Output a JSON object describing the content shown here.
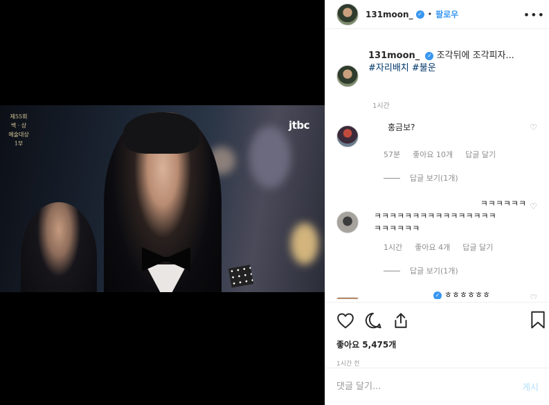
{
  "video": {
    "broadcaster_logo": "jtbc",
    "event_logo_lines": [
      "제55회",
      "백 · 상",
      "예술대상",
      "1부"
    ]
  },
  "header": {
    "username": "131moon_",
    "follow_label": "팔로우",
    "separator": "•",
    "more_icon": "more-icon"
  },
  "caption": {
    "username": "131moon_",
    "text": "조각뒤에 조각피자...",
    "hashtags": [
      "#자리배치",
      "#불운"
    ],
    "time": "1시간"
  },
  "comments": [
    {
      "text": "홍금보?",
      "time": "57분",
      "likes": "좋아요 10개",
      "reply_label": "답글 달기",
      "view_replies": "답글 보기(1개)"
    },
    {
      "text_lines": [
        "ㅋㅋㅋㅋㅋㅋ",
        "ㅋㅋㅋㅋㅋㅋㅋㅋㅋㅋㅋㅋㅋㅋㅋㅋ",
        "ㅋㅋㅋㅋㅋㅋ"
      ],
      "time": "1시간",
      "likes": "좋아요 4개",
      "reply_label": "답글 달기",
      "view_replies": "답글 보기(1개)"
    },
    {
      "text": "ㅎㅎㅎㅎㅎㅎ"
    }
  ],
  "actions": {
    "likes": "좋아요 5,475개",
    "time_ago": "1시간 전"
  },
  "comment_box": {
    "placeholder": "댓글 달기...",
    "post_label": "게시"
  },
  "colors": {
    "link_blue": "#3897f0",
    "hashtag": "#003569",
    "muted": "#8e8e8e",
    "post_disabled": "#b2dffc"
  }
}
